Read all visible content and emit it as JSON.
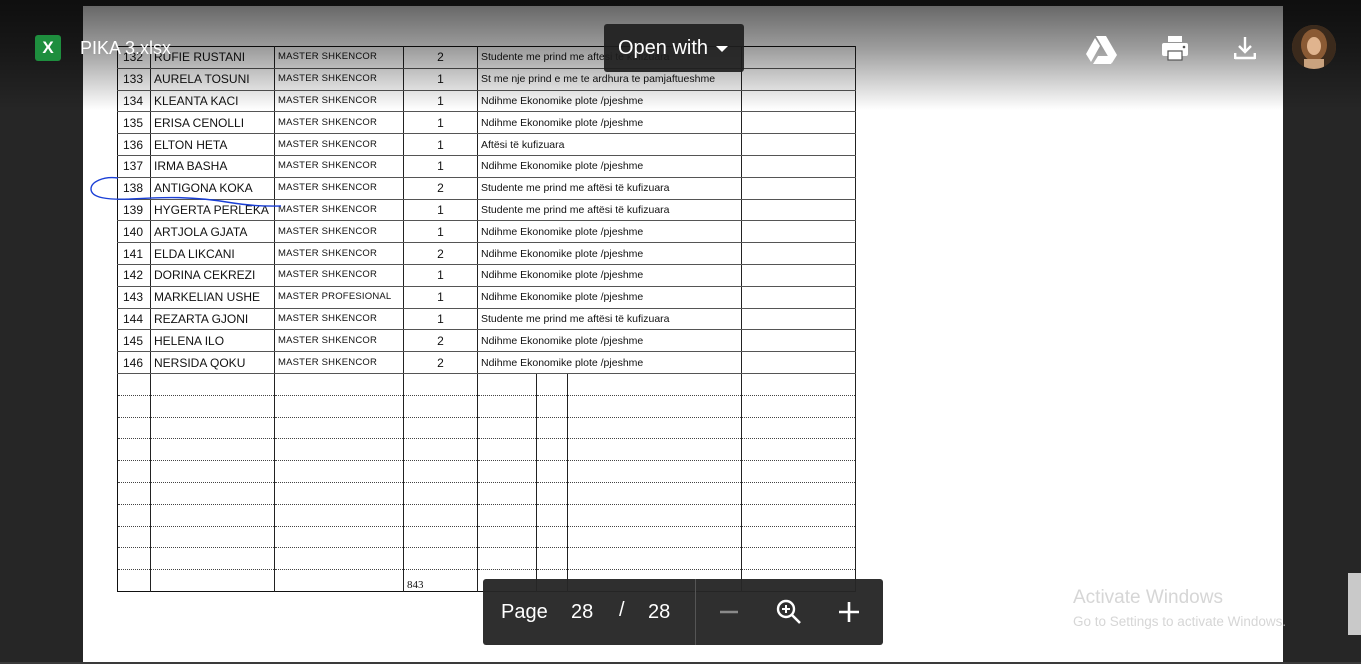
{
  "file": {
    "name": "PIKA 3.xlsx",
    "app_icon_letter": "X"
  },
  "toolbar": {
    "open_with_label": "Open with"
  },
  "sheet": {
    "rows": [
      {
        "no": "132",
        "name": "RUFIE RUSTANI",
        "program": "MASTER SHKENCOR",
        "count": "2",
        "desc": "Studente me prind me aftesi te kufizuara"
      },
      {
        "no": "133",
        "name": "AURELA TOSUNI",
        "program": "MASTER SHKENCOR",
        "count": "1",
        "desc": "St me nje prind e me te ardhura te pamjaftueshme"
      },
      {
        "no": "134",
        "name": "KLEANTA KACI",
        "program": "MASTER SHKENCOR",
        "count": "1",
        "desc": "Ndihme Ekonomike plote /pjeshme"
      },
      {
        "no": "135",
        "name": "ERISA CENOLLI",
        "program": "MASTER SHKENCOR",
        "count": "1",
        "desc": "Ndihme Ekonomike plote /pjeshme"
      },
      {
        "no": "136",
        "name": "ELTON HETA",
        "program": "MASTER SHKENCOR",
        "count": "1",
        "desc": "Aftësi të kufizuara"
      },
      {
        "no": "137",
        "name": "IRMA BASHA",
        "program": "MASTER SHKENCOR",
        "count": "1",
        "desc": "Ndihme Ekonomike plote /pjeshme"
      },
      {
        "no": "138",
        "name": "ANTIGONA KOKA",
        "program": "MASTER SHKENCOR",
        "count": "2",
        "desc": "Studente me prind me aftësi të kufizuara"
      },
      {
        "no": "139",
        "name": "HYGERTA PERLEKA",
        "program": "MASTER SHKENCOR",
        "count": "1",
        "desc": "Studente me prind me aftësi të kufizuara"
      },
      {
        "no": "140",
        "name": "ARTJOLA GJATA",
        "program": "MASTER SHKENCOR",
        "count": "1",
        "desc": "Ndihme Ekonomike plote /pjeshme"
      },
      {
        "no": "141",
        "name": "ELDA LIKCANI",
        "program": "MASTER SHKENCOR",
        "count": "2",
        "desc": "Ndihme Ekonomike plote /pjeshme"
      },
      {
        "no": "142",
        "name": "DORINA CEKREZI",
        "program": "MASTER SHKENCOR",
        "count": "1",
        "desc": "Ndihme Ekonomike plote /pjeshme"
      },
      {
        "no": "143",
        "name": "MARKELIAN USHE",
        "program": "MASTER PROFESIONAL",
        "count": "1",
        "desc": "Ndihme Ekonomike plote /pjeshme"
      },
      {
        "no": "144",
        "name": "REZARTA GJONI",
        "program": "MASTER SHKENCOR",
        "count": "1",
        "desc": "Studente me prind me aftësi të kufizuara"
      },
      {
        "no": "145",
        "name": "HELENA ILO",
        "program": "MASTER SHKENCOR",
        "count": "2",
        "desc": "Ndihme Ekonomike plote /pjeshme"
      },
      {
        "no": "146",
        "name": "NERSIDA QOKU",
        "program": "MASTER SHKENCOR",
        "count": "2",
        "desc": "Ndihme Ekonomike plote /pjeshme"
      }
    ],
    "page_number": "843"
  },
  "pager": {
    "label": "Page",
    "current": "28",
    "separator": "/",
    "total": "28"
  },
  "watermark": {
    "line1": "Activate Windows",
    "line2": "Go to Settings to activate Windows."
  },
  "icons": [
    "google-drive-icon",
    "print-icon",
    "download-icon",
    "avatar",
    "zoom-out-icon",
    "zoom-in-icon",
    "plus-icon"
  ],
  "colors": {
    "background": "#262626",
    "excel_green": "#1e8e3e",
    "pen_ink": "#1a3fd6"
  }
}
